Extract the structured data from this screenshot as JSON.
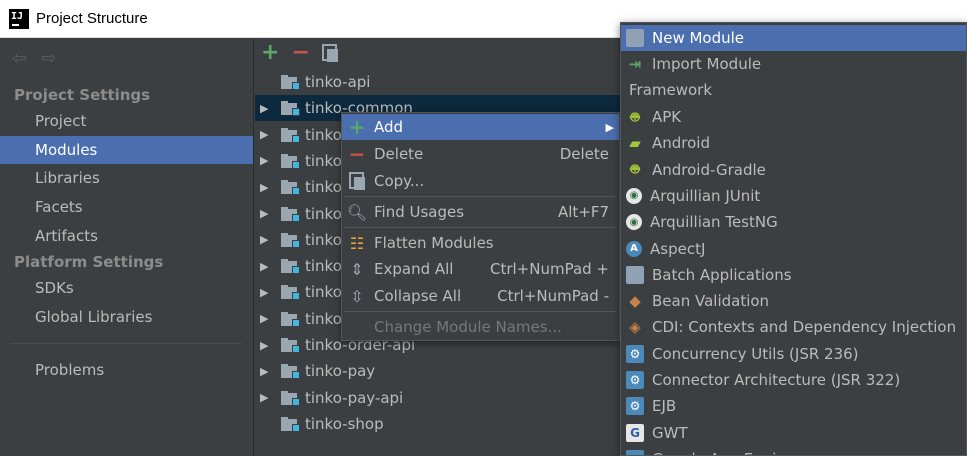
{
  "window": {
    "title": "Project Structure"
  },
  "sidebar": {
    "sections": [
      {
        "title": "Project Settings",
        "items": [
          "Project",
          "Modules",
          "Libraries",
          "Facets",
          "Artifacts"
        ]
      },
      {
        "title": "Platform Settings",
        "items": [
          "SDKs",
          "Global Libraries"
        ]
      }
    ],
    "problems": "Problems",
    "selected": "Modules"
  },
  "tree": {
    "rows": [
      {
        "label": "tinko-api",
        "expandable": false
      },
      {
        "label": "tinko-common",
        "expandable": true
      },
      {
        "label": "tinko",
        "expandable": true
      },
      {
        "label": "tinko",
        "expandable": true
      },
      {
        "label": "tinko",
        "expandable": true
      },
      {
        "label": "tinko",
        "expandable": true
      },
      {
        "label": "tinko",
        "expandable": true
      },
      {
        "label": "tinko",
        "expandable": true
      },
      {
        "label": "tinko",
        "expandable": true
      },
      {
        "label": "tinko",
        "expandable": true
      },
      {
        "label": "tinko-order-api",
        "expandable": true
      },
      {
        "label": "tinko-pay",
        "expandable": true
      },
      {
        "label": "tinko-pay-api",
        "expandable": true
      },
      {
        "label": "tinko-shop",
        "expandable": false
      }
    ]
  },
  "context_menu": {
    "add": {
      "label": "Add"
    },
    "delete": {
      "label": "Delete",
      "shortcut": "Delete"
    },
    "copy": {
      "label": "Copy..."
    },
    "find_usages": {
      "label": "Find Usages",
      "shortcut": "Alt+F7"
    },
    "flatten": {
      "label": "Flatten Modules"
    },
    "expand": {
      "label": "Expand All",
      "shortcut": "Ctrl+NumPad +"
    },
    "collapse": {
      "label": "Collapse All",
      "shortcut": "Ctrl+NumPad -"
    },
    "change_names": {
      "label": "Change Module Names..."
    }
  },
  "submenu": {
    "new_module": "New Module",
    "import_module": "Import Module",
    "framework_header": "Framework",
    "frameworks": [
      {
        "label": "APK",
        "icon": "android-icon"
      },
      {
        "label": "Android",
        "icon": "android-folder-icon"
      },
      {
        "label": "Android-Gradle",
        "icon": "android-icon"
      },
      {
        "label": "Arquillian JUnit",
        "icon": "arquillian-icon"
      },
      {
        "label": "Arquillian TestNG",
        "icon": "arquillian-icon"
      },
      {
        "label": "AspectJ",
        "icon": "aspectj-icon"
      },
      {
        "label": "Batch Applications",
        "icon": "batch-icon"
      },
      {
        "label": "Bean Validation",
        "icon": "bean-validation-icon"
      },
      {
        "label": "CDI: Contexts and Dependency Injection",
        "icon": "cdi-icon"
      },
      {
        "label": "Concurrency Utils (JSR 236)",
        "icon": "concurrency-icon"
      },
      {
        "label": "Connector Architecture (JSR 322)",
        "icon": "connector-icon"
      },
      {
        "label": "EJB",
        "icon": "ejb-icon"
      },
      {
        "label": "GWT",
        "icon": "gwt-icon"
      },
      {
        "label": "Google App Engine",
        "icon": "google-app-engine-icon"
      }
    ]
  },
  "colors": {
    "selection": "#4b6eaf",
    "background": "#3c3f41",
    "text": "#bbbbbb",
    "tree_selection": "#0d293e"
  }
}
